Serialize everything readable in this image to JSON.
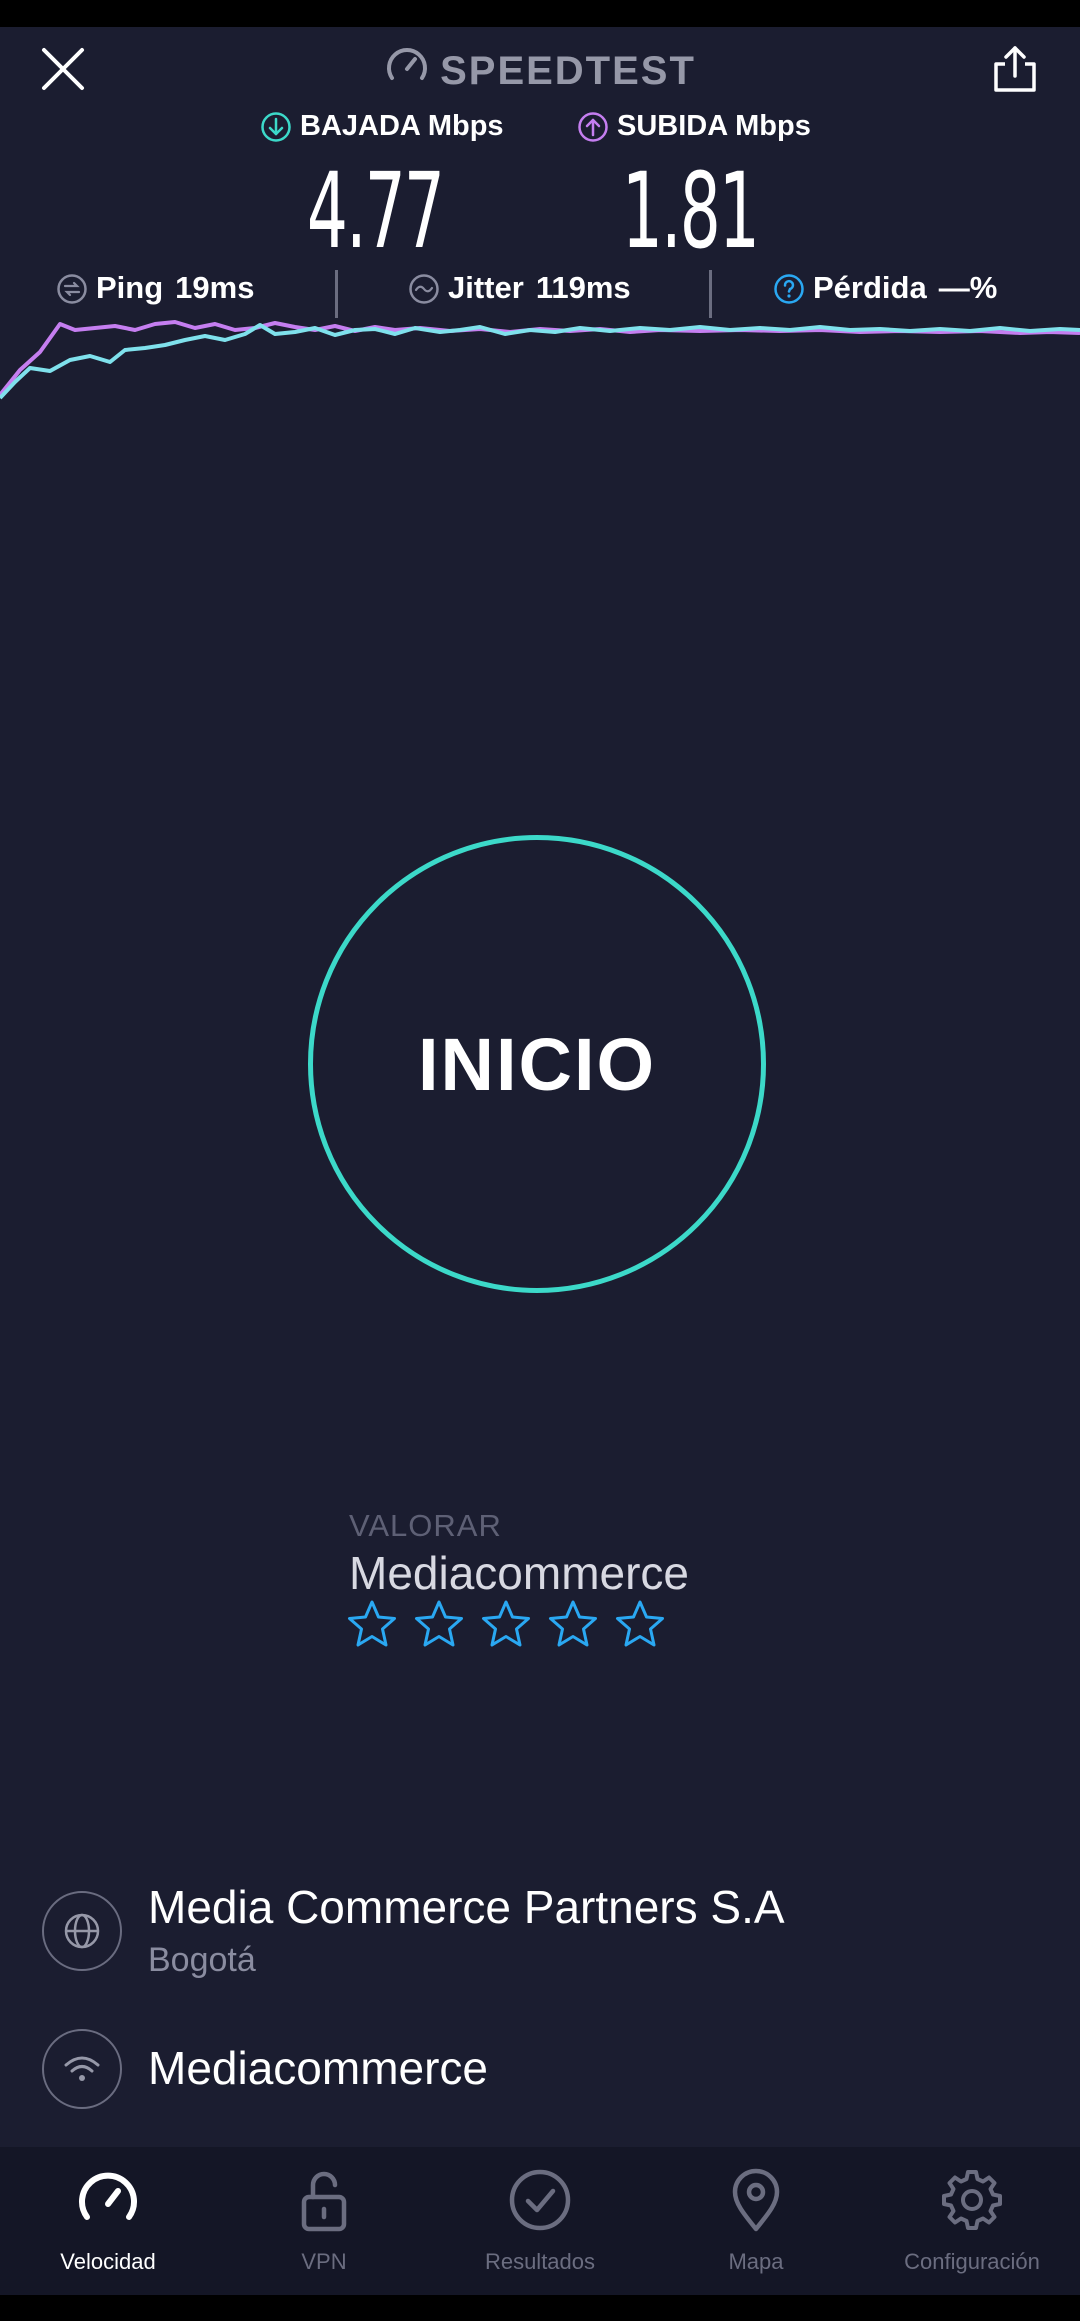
{
  "header": {
    "title": "SPEEDTEST"
  },
  "metrics": {
    "download": {
      "label": "BAJADA Mbps",
      "value": "4.77"
    },
    "upload": {
      "label": "SUBIDA Mbps",
      "value": "1.81"
    }
  },
  "stats": {
    "ping": {
      "label": "Ping",
      "value": "19ms"
    },
    "jitter": {
      "label": "Jitter",
      "value": "119ms"
    },
    "loss": {
      "label": "Pérdida",
      "value": "—%"
    }
  },
  "start_button": {
    "label": "INICIO"
  },
  "rating": {
    "label": "VALORAR",
    "isp": "Mediacommerce",
    "stars": 5
  },
  "server": {
    "name": "Media Commerce Partners S.A",
    "location": "Bogotá"
  },
  "network": {
    "name": "Mediacommerce"
  },
  "tabs": [
    {
      "label": "Velocidad",
      "icon": "speed-gauge-icon",
      "active": true
    },
    {
      "label": "VPN",
      "icon": "lock-icon",
      "active": false
    },
    {
      "label": "Resultados",
      "icon": "check-circle-icon",
      "active": false
    },
    {
      "label": "Mapa",
      "icon": "map-pin-icon",
      "active": false
    },
    {
      "label": "Configuración",
      "icon": "gear-icon",
      "active": false
    }
  ],
  "colors": {
    "background": "#1b1d30",
    "download_accent": "#3cd9c9",
    "upload_accent": "#c57ef0",
    "star_accent": "#2aa8f2",
    "tabbar": "#141626"
  }
}
